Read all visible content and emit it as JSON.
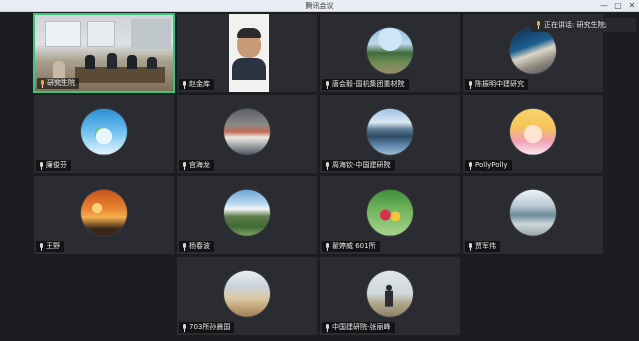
{
  "window": {
    "title": "腾讯会议",
    "minimize": "—",
    "maximize": "▢",
    "close": "✕"
  },
  "speaking": {
    "label": "正在讲话: 研究生院;"
  },
  "participants": [
    {
      "name": "研究生院",
      "mic": "live",
      "active": true,
      "kind": "video-room"
    },
    {
      "name": "赵金库",
      "mic": "on",
      "active": false,
      "kind": "video-person"
    },
    {
      "name": "唐会毅-国机集团重材院",
      "mic": "on",
      "active": false,
      "kind": "avatar-landscape"
    },
    {
      "name": "陈振明中建研究",
      "mic": "on",
      "active": false,
      "kind": "avatar-train"
    },
    {
      "name": "廉俊芬",
      "mic": "on",
      "active": false,
      "kind": "avatar-globe"
    },
    {
      "name": "宫海龙",
      "mic": "on",
      "active": false,
      "kind": "avatar-room"
    },
    {
      "name": "周海钦-中国建研院",
      "mic": "on",
      "active": false,
      "kind": "avatar-lake"
    },
    {
      "name": "PollyPolly",
      "mic": "on",
      "active": false,
      "kind": "avatar-anime"
    },
    {
      "name": "王野",
      "mic": "on",
      "active": false,
      "kind": "avatar-sunset"
    },
    {
      "name": "杨春波",
      "mic": "on",
      "active": false,
      "kind": "avatar-mountain"
    },
    {
      "name": "翟婷威 601所",
      "mic": "on",
      "active": false,
      "kind": "avatar-cartoon"
    },
    {
      "name": "贾军伟",
      "mic": "on",
      "active": false,
      "kind": "avatar-aerial"
    },
    {
      "name": "703所孙晨国",
      "mic": "on",
      "active": false,
      "kind": "avatar-beach"
    },
    {
      "name": "中国建研院-张丽峰",
      "mic": "on",
      "active": false,
      "kind": "avatar-person"
    }
  ]
}
